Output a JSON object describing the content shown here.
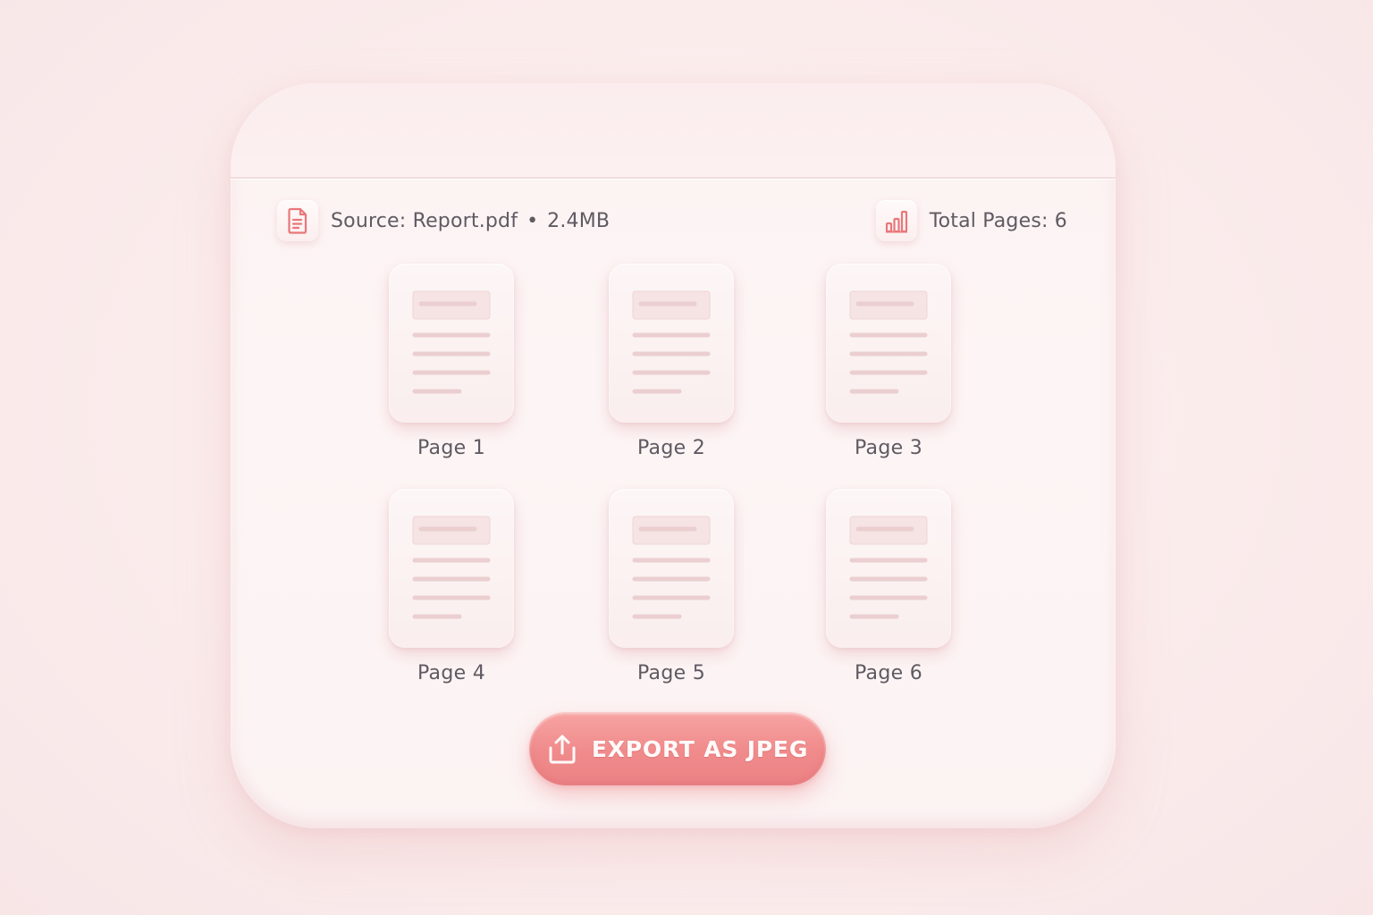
{
  "source": {
    "label": "Source: Report.pdf",
    "separator": "•",
    "size": "2.4MB",
    "icon": "document-icon"
  },
  "total": {
    "label": "Total Pages: 6",
    "icon": "bar-chart-icon"
  },
  "pages": [
    {
      "label": "Page 1",
      "icon": "page-thumbnail-icon"
    },
    {
      "label": "Page 2",
      "icon": "page-thumbnail-icon"
    },
    {
      "label": "Page 3",
      "icon": "page-thumbnail-icon"
    },
    {
      "label": "Page 4",
      "icon": "page-thumbnail-icon"
    },
    {
      "label": "Page 5",
      "icon": "page-thumbnail-icon"
    },
    {
      "label": "Page 6",
      "icon": "page-thumbnail-icon"
    }
  ],
  "export_button": {
    "label": "EXPORT AS JPEG",
    "icon": "upload-icon"
  },
  "colors": {
    "accent": "#f08a8b",
    "icon_accent": "#e8777a",
    "text": "#5f5a62",
    "background": "#fcf2f2"
  }
}
